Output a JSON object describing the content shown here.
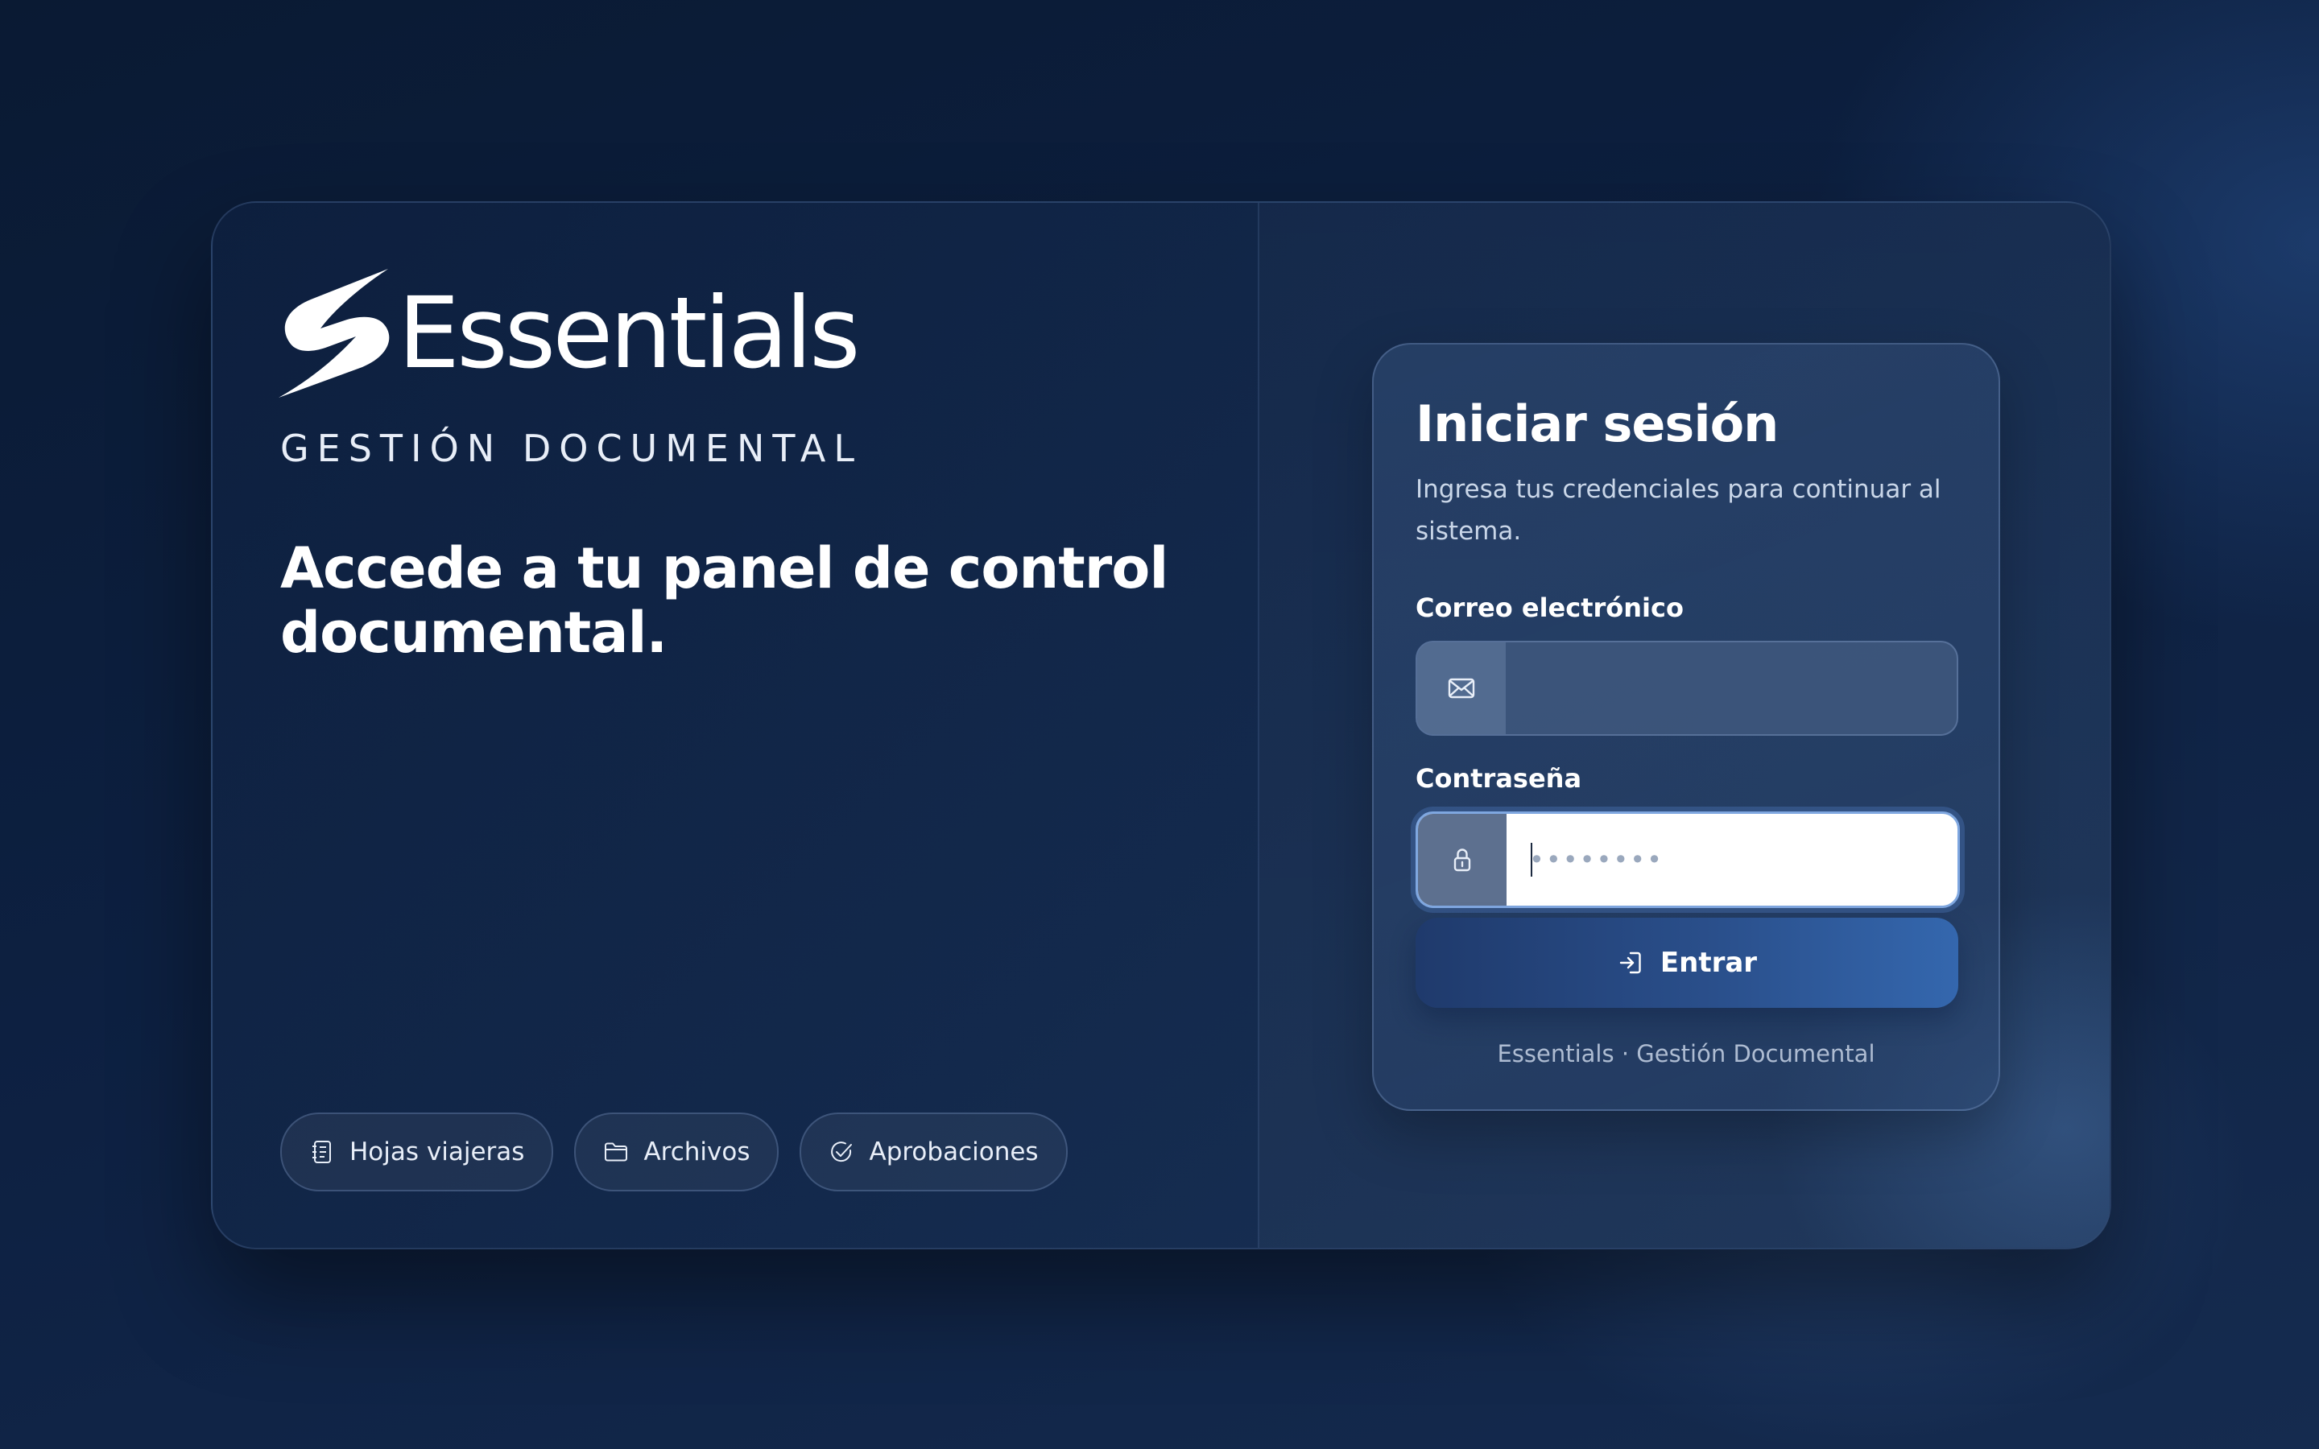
{
  "brand": {
    "name": "Essentials",
    "subtitle": "GESTIÓN DOCUMENTAL",
    "accent_color": "#4a9ee6"
  },
  "hero": {
    "headline": "Accede a tu panel de control documental."
  },
  "chips": [
    {
      "label": "Hojas viajeras",
      "icon": "notebook-icon"
    },
    {
      "label": "Archivos",
      "icon": "folder-icon"
    },
    {
      "label": "Aprobaciones",
      "icon": "check-circle-icon"
    }
  ],
  "login": {
    "title": "Iniciar sesión",
    "description": "Ingresa tus credenciales para continuar al sistema.",
    "email": {
      "label": "Correo electrónico",
      "value": "",
      "placeholder": "",
      "icon": "envelope-icon"
    },
    "password": {
      "label": "Contraseña",
      "value": "",
      "placeholder": "••••••••",
      "icon": "lock-icon"
    },
    "submit_label": "Entrar",
    "submit_icon": "sign-in-icon",
    "footer": "Essentials · Gestión Documental"
  }
}
